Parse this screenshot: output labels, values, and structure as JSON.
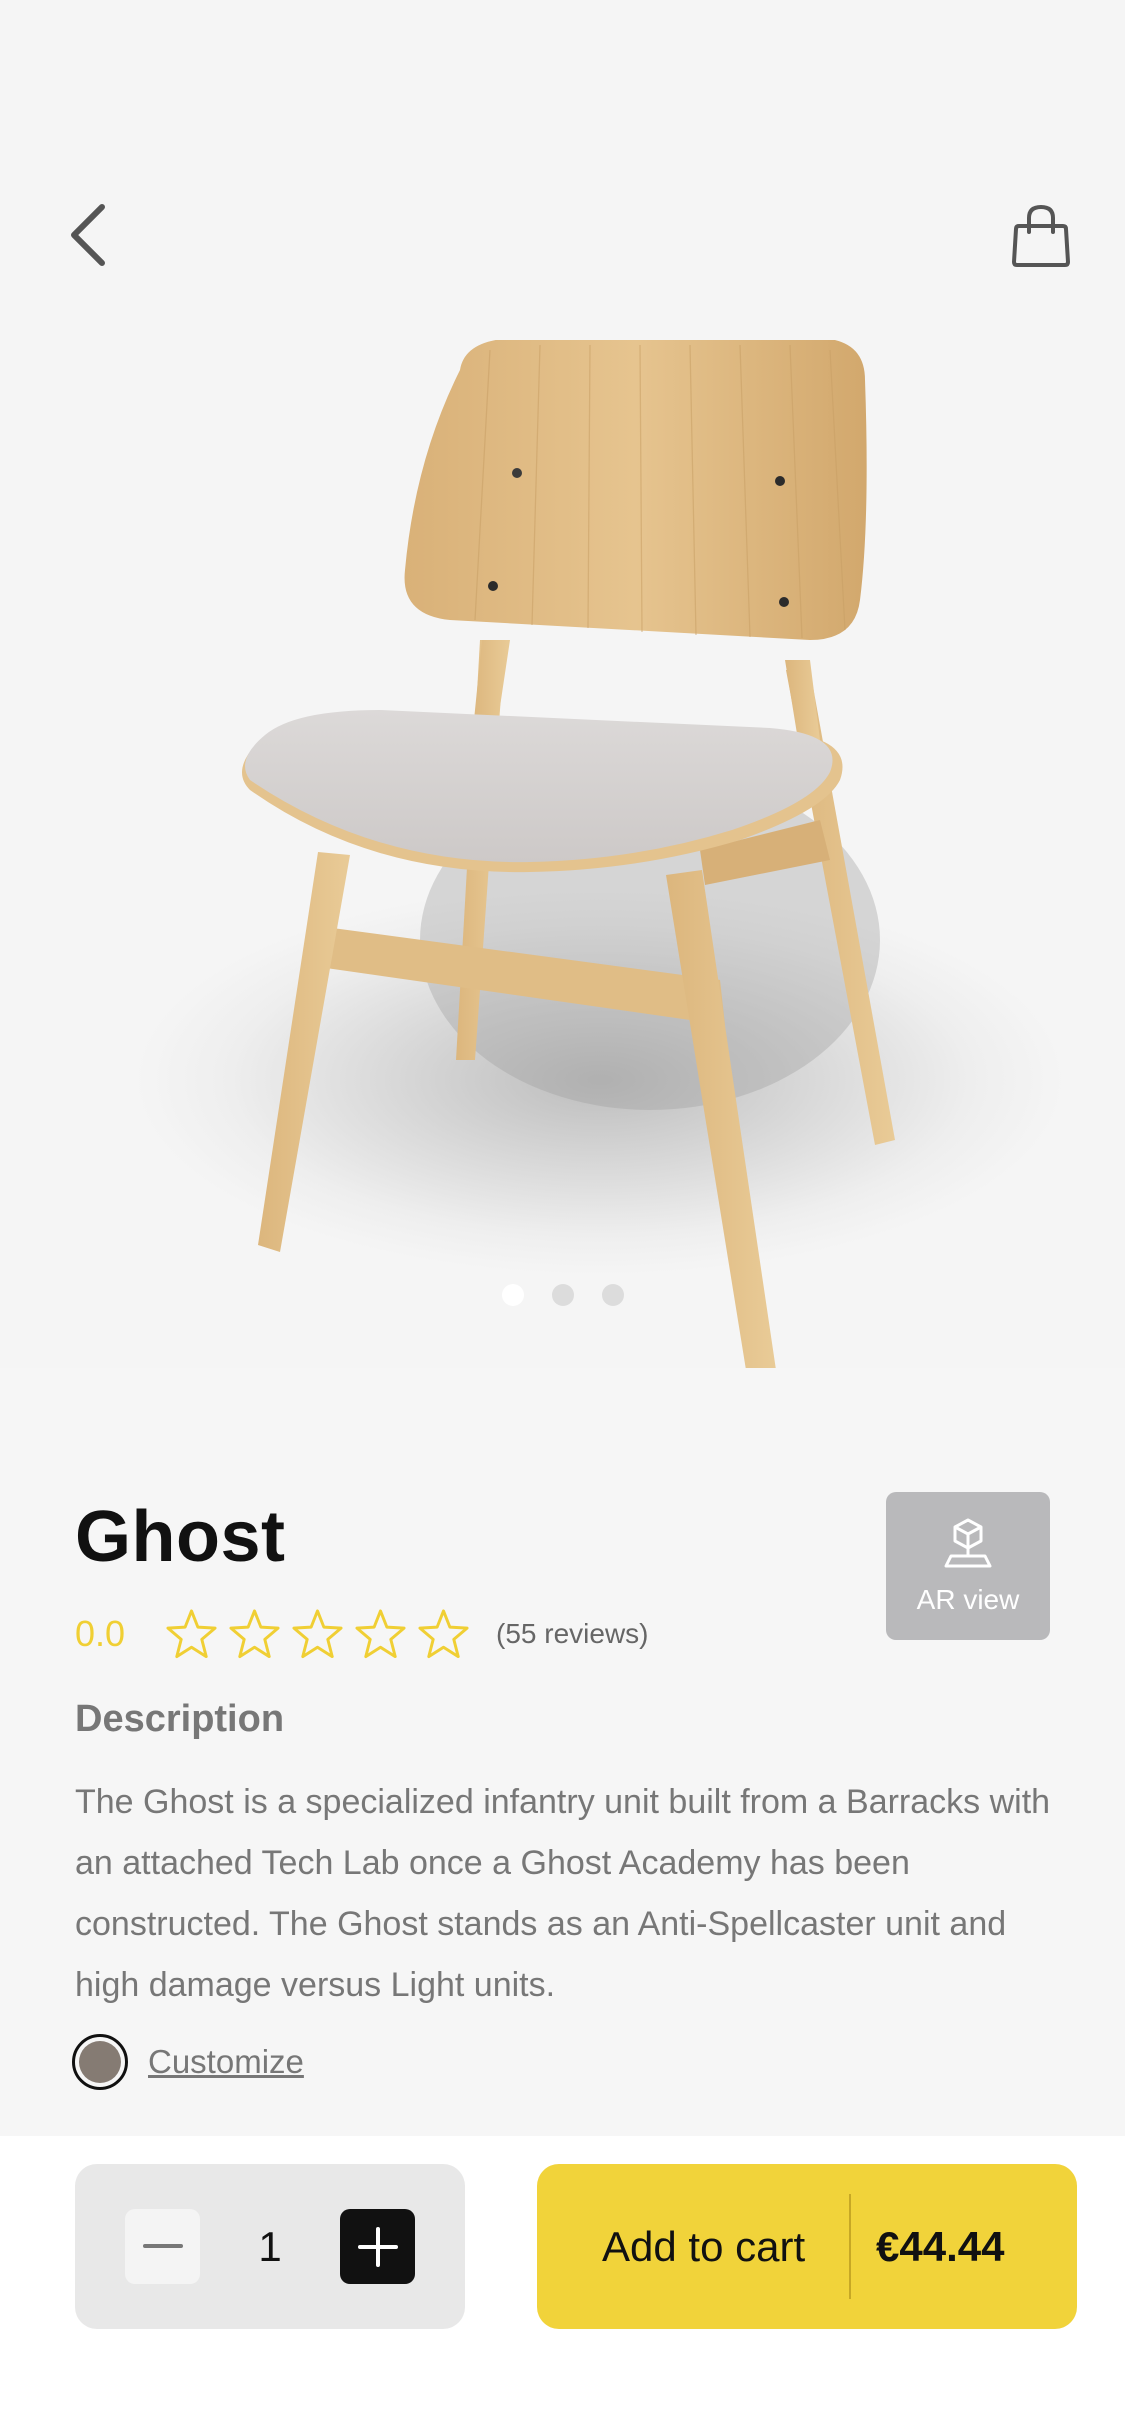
{
  "header": {
    "back_icon": "chevron-left-icon",
    "bag_icon": "shopping-bag-icon"
  },
  "gallery": {
    "image": "wooden-chair-image",
    "slide_count": 3,
    "active_slide": 1
  },
  "product": {
    "title": "Ghost",
    "rating_value": "0.0",
    "stars_filled": 0,
    "stars_total": 5,
    "reviews_text": "(55 reviews)",
    "ar_button_label": "AR view",
    "ar_icon": "ar-cube-icon",
    "description_heading": "Description",
    "description_text": "The Ghost is a specialized infantry unit built from a Barracks with an attached Tech Lab once a Ghost Academy has been constructed. The Ghost stands as an Anti-Spellcaster unit and high damage versus Light units.",
    "customize_label": "Customize",
    "swatch_color": "#857b73"
  },
  "cart": {
    "quantity": "1",
    "add_to_cart_label": "Add to cart",
    "price": "€44.44",
    "accent_color": "#f1d33a"
  }
}
